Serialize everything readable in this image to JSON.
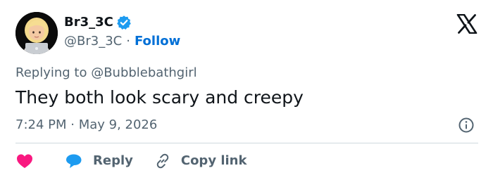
{
  "author": {
    "display_name": "Br3_3C",
    "handle": "@Br3_3C",
    "separator": "·",
    "follow_label": "Follow",
    "verified": true
  },
  "tweet": {
    "reply_context": "Replying to @Bubblebathgirl",
    "text": "They both look scary and creepy",
    "timestamp": "7:24 PM · May 9, 2026"
  },
  "actions": {
    "reply_label": "Reply",
    "copy_link_label": "Copy link"
  },
  "icons": {
    "verified": "verified-badge-icon",
    "logo": "x-logo-icon",
    "info": "info-icon",
    "like": "heart-icon",
    "reply": "speech-bubble-icon",
    "copy_link": "link-icon"
  },
  "colors": {
    "text_primary": "#0f1419",
    "text_secondary": "#536471",
    "link_blue": "#006fd6",
    "verified_blue": "#1d9bf0",
    "like_pink": "#f91880",
    "divider": "#cfd9de"
  }
}
